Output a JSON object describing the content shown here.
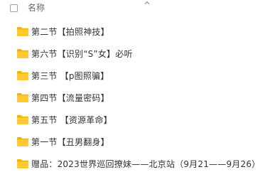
{
  "header": {
    "column_name_label": "名称",
    "sort_icon": "chevron-up-icon"
  },
  "files": [
    {
      "name": "第二节【拍照神技】",
      "icon": "folder-icon"
    },
    {
      "name": "第六节【识别“S”女】必听",
      "icon": "folder-icon"
    },
    {
      "name": "第三节 【p图照骗】",
      "icon": "folder-icon"
    },
    {
      "name": "第四节【流量密码】",
      "icon": "folder-icon"
    },
    {
      "name": "第五节 【资源革命】",
      "icon": "folder-icon"
    },
    {
      "name": "第一节【丑男翻身】",
      "icon": "folder-icon"
    },
    {
      "name": "赠品：2023世界巡回撩妹——北京站（9月21——9月26）",
      "icon": "folder-icon"
    }
  ],
  "colors": {
    "folder_body": "#ffc933",
    "folder_tab": "#f5b400",
    "text": "#333333",
    "header_text": "#666666"
  }
}
